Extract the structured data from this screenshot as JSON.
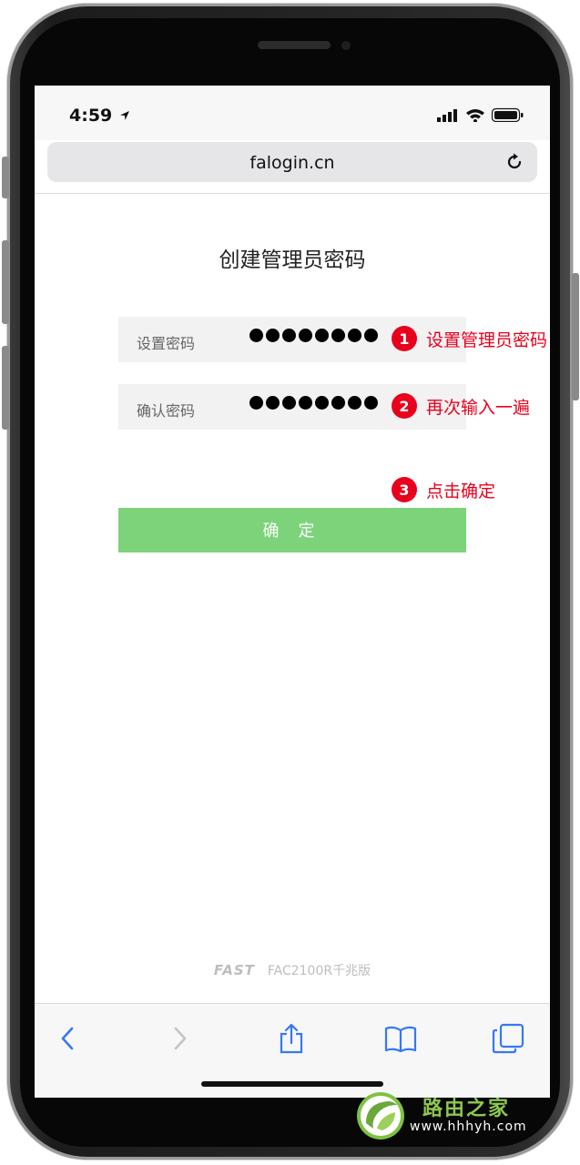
{
  "status": {
    "time": "4:59"
  },
  "browser": {
    "url": "falogin.cn"
  },
  "page": {
    "title": "创建管理员密码",
    "fields": [
      {
        "label": "设置密码",
        "masked_length": 8
      },
      {
        "label": "确认密码",
        "masked_length": 8
      }
    ],
    "confirm_label": "确 定"
  },
  "annotations": [
    {
      "num": "1",
      "text": "设置管理员密码"
    },
    {
      "num": "2",
      "text": "再次输入一遍"
    },
    {
      "num": "3",
      "text": "点击确定"
    }
  ],
  "footer": {
    "brand": "FAST",
    "model": "FAC2100R千兆版"
  },
  "toolbar": {
    "icons": [
      "back-icon",
      "forward-icon",
      "share-icon",
      "bookmarks-icon",
      "tabs-icon"
    ],
    "accent": "#3478f6",
    "disabled": "#c3c3c8"
  },
  "watermark": {
    "title": "路由之家",
    "url": "www.hhhyh.com"
  },
  "colors": {
    "annotation_red": "#e8001c",
    "confirm_green": "#7dd37a"
  }
}
